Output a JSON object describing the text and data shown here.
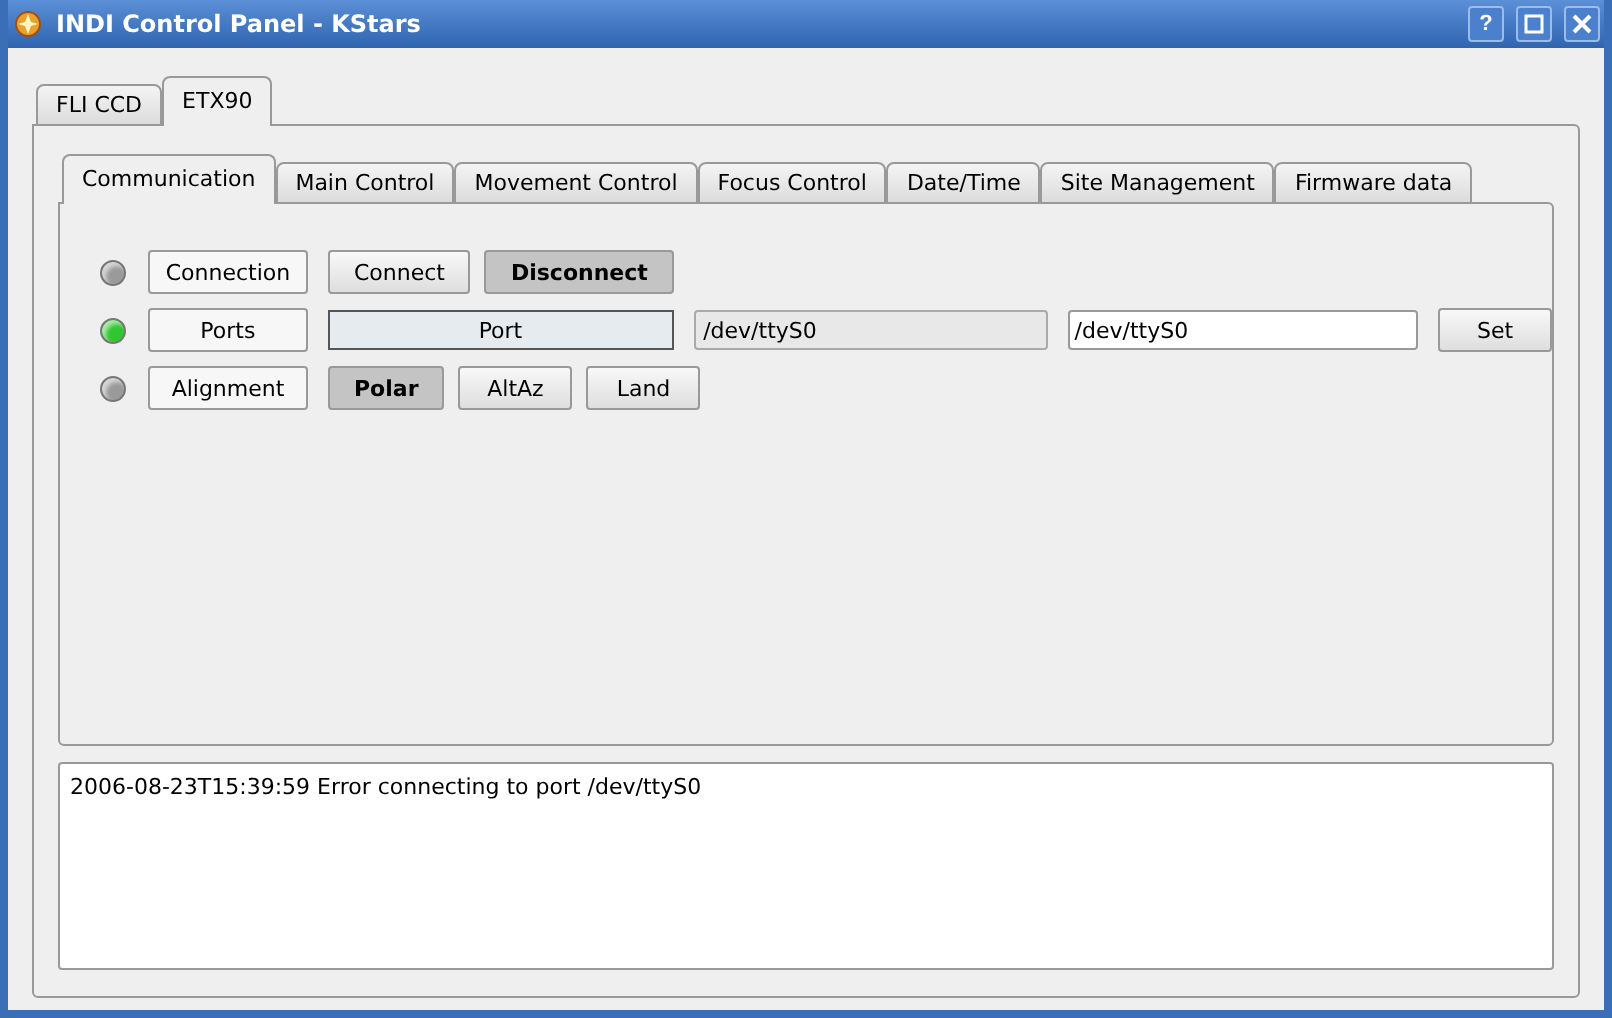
{
  "window": {
    "title": "INDI Control Panel - KStars",
    "buttons": [
      {
        "kind": "help",
        "label": "?"
      },
      {
        "kind": "maximize"
      },
      {
        "kind": "close"
      }
    ]
  },
  "device_tabs": [
    {
      "label": "FLI CCD",
      "selected": false
    },
    {
      "label": "ETX90",
      "selected": true
    }
  ],
  "group_tabs": [
    {
      "label": "Communication",
      "selected": true
    },
    {
      "label": "Main Control",
      "selected": false
    },
    {
      "label": "Movement Control",
      "selected": false
    },
    {
      "label": "Focus Control",
      "selected": false
    },
    {
      "label": "Date/Time",
      "selected": false
    },
    {
      "label": "Site Management",
      "selected": false
    },
    {
      "label": "Firmware data",
      "selected": false
    }
  ],
  "properties": [
    {
      "kind": "switch",
      "label": "Connection",
      "color": "#9a9a9a",
      "switches": [
        {
          "label": "Connect",
          "selected": false
        },
        {
          "label": "Disconnect",
          "selected": true
        }
      ]
    },
    {
      "kind": "text",
      "label": "Ports",
      "color": "#2fc62f",
      "element": "Port",
      "current": "/dev/ttyS0",
      "value": "/dev/ttyS0",
      "set_label": "Set"
    },
    {
      "kind": "switch",
      "label": "Alignment",
      "color": "#9a9a9a",
      "switches": [
        {
          "label": "Polar",
          "selected": true
        },
        {
          "label": "AltAz",
          "selected": false
        },
        {
          "label": "Land",
          "selected": false
        }
      ]
    }
  ],
  "log": [
    "2006-08-23T15:39:59 Error connecting to port /dev/ttyS0"
  ]
}
